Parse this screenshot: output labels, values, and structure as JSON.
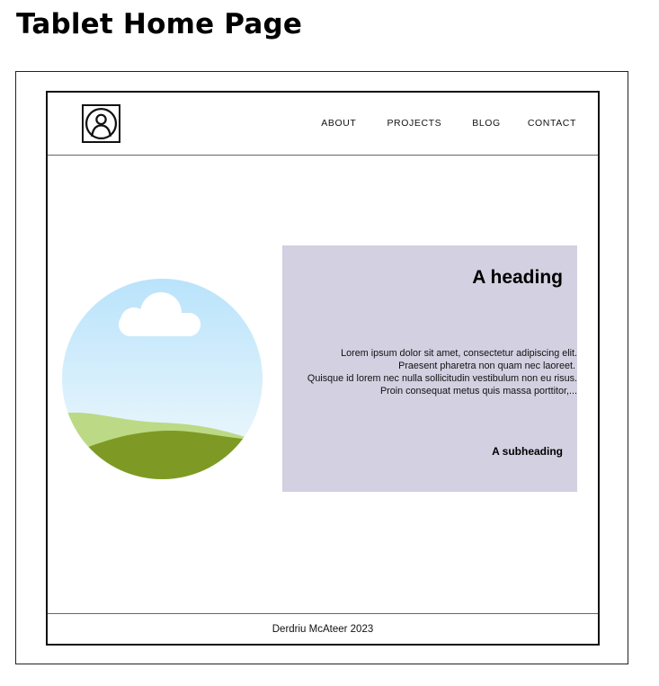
{
  "page": {
    "title": "Tablet Home Page"
  },
  "header": {
    "logo_icon": "user-portrait-icon",
    "nav": [
      {
        "label": "ABOUT"
      },
      {
        "label": "PROJECTS"
      },
      {
        "label": "BLOG"
      },
      {
        "label": "CONTACT"
      }
    ]
  },
  "hero": {
    "image_icon": "landscape-illustration-icon",
    "colors": {
      "sky_top": "#b9e3fb",
      "sky_bottom": "#eef8fd",
      "cloud": "#ffffff",
      "hill_light": "#bcd985",
      "hill_dark": "#7e9a24"
    }
  },
  "card": {
    "background": "#d3d0e1",
    "heading": "A heading",
    "body_lines": [
      "Lorem ipsum dolor sit amet, consectetur adipiscing elit.",
      "Praesent pharetra non quam nec laoreet.",
      "Quisque id lorem nec nulla sollicitudin vestibulum non eu risus.",
      "Proin consequat metus quis massa porttitor,..."
    ],
    "subheading": "A subheading"
  },
  "footer": {
    "text": "Derdriu McAteer 2023"
  }
}
